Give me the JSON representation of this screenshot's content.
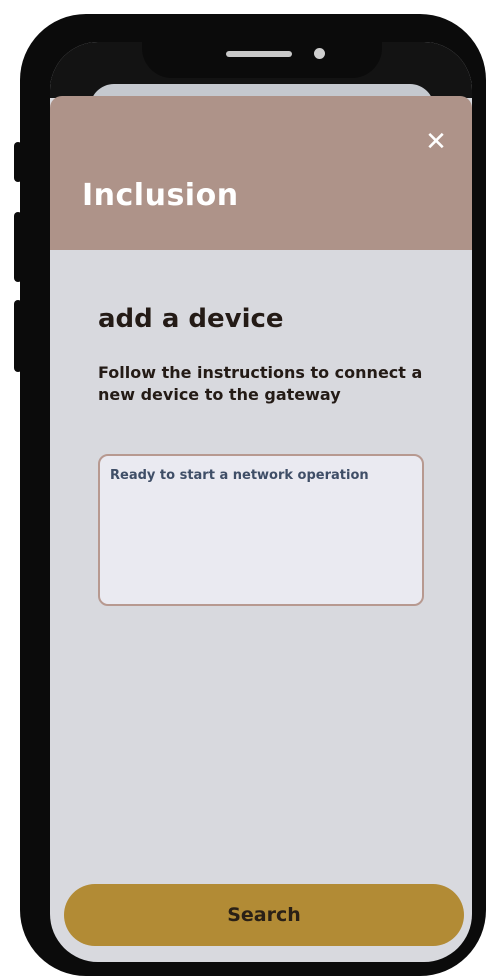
{
  "header": {
    "title": "Inclusion",
    "close_icon": "close-icon",
    "background": "#ae9389"
  },
  "main": {
    "heading": "add a device",
    "instructions": "Follow the instructions to connect a new device to the  gateway",
    "status_text": "Ready to start a network operation"
  },
  "actions": {
    "search_label": "Search",
    "accent": "#b28b35"
  }
}
